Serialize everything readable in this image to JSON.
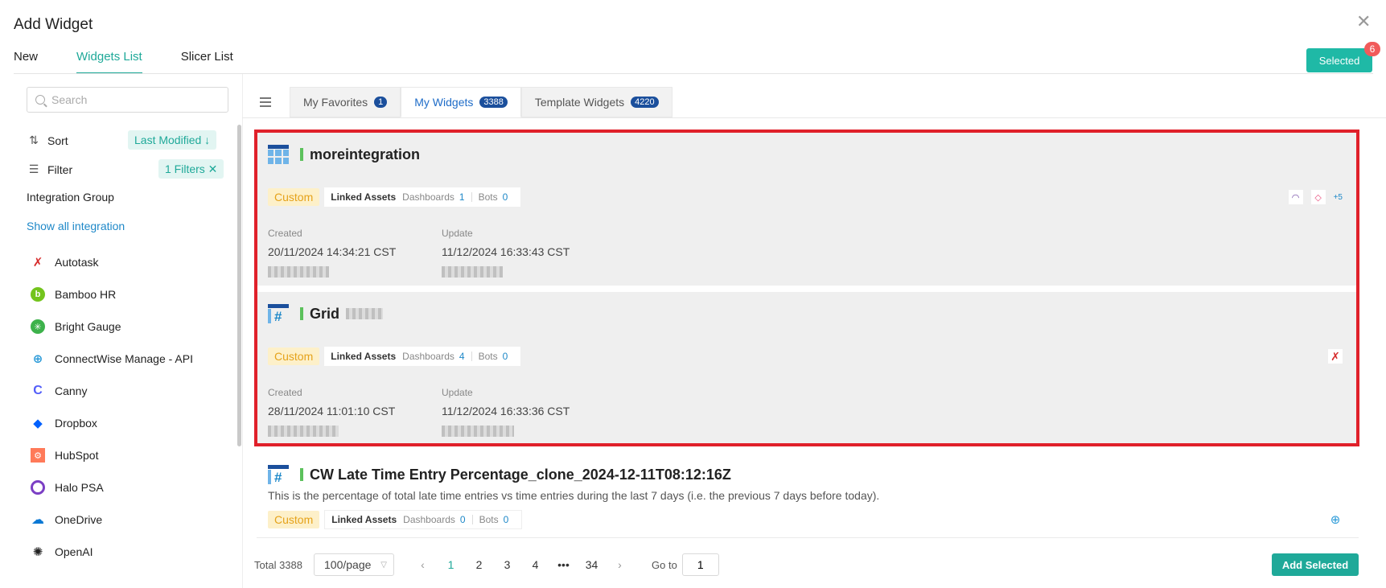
{
  "dialog": {
    "title": "Add Widget",
    "close": "✕"
  },
  "main_tabs": [
    {
      "label": "New"
    },
    {
      "label": "Widgets List"
    },
    {
      "label": "Slicer List"
    }
  ],
  "selected": {
    "label": "Selected",
    "count": "6"
  },
  "sidebar": {
    "search_placeholder": "Search",
    "sort_label": "Sort",
    "sort_value": "Last Modified ↓",
    "filter_label": "Filter",
    "filter_value": "1 Filters ✕",
    "integration_group": "Integration Group",
    "show_all": "Show all integration",
    "integrations": [
      {
        "name": "Autotask",
        "color": "#d62b2b"
      },
      {
        "name": "Bamboo HR",
        "color": "#73c41d"
      },
      {
        "name": "Bright Gauge",
        "color": "#3db24b"
      },
      {
        "name": "ConnectWise Manage - API",
        "color": "#2a9ad8"
      },
      {
        "name": "Canny",
        "color": "#525df9"
      },
      {
        "name": "Dropbox",
        "color": "#0061fe"
      },
      {
        "name": "HubSpot",
        "color": "#ff7a59"
      },
      {
        "name": "Halo PSA",
        "color": "#7b3fc4"
      },
      {
        "name": "OneDrive",
        "color": "#0a78d4"
      },
      {
        "name": "OpenAI",
        "color": "#222222"
      }
    ]
  },
  "sub_tabs": [
    {
      "label": "My Favorites",
      "count": "1"
    },
    {
      "label": "My Widgets",
      "count": "3388"
    },
    {
      "label": "Template Widgets",
      "count": "4220"
    }
  ],
  "widgets": [
    {
      "title": "moreintegration",
      "tag": "Custom",
      "linked_label": "Linked Assets",
      "dashboards_label": "Dashboards",
      "dashboards": "1",
      "bots_label": "Bots",
      "bots": "0",
      "created_label": "Created",
      "created": "20/11/2024 14:34:21 CST",
      "update_label": "Update",
      "update": "11/12/2024 16:33:43 CST",
      "more": "+5"
    },
    {
      "title": "Grid",
      "tag": "Custom",
      "linked_label": "Linked Assets",
      "dashboards_label": "Dashboards",
      "dashboards": "4",
      "bots_label": "Bots",
      "bots": "0",
      "created_label": "Created",
      "created": "28/11/2024 11:01:10 CST",
      "update_label": "Update",
      "update": "11/12/2024 16:33:36 CST"
    },
    {
      "title": "CW Late Time Entry Percentage_clone_2024-12-11T08:12:16Z",
      "description": "This is the percentage of total late time entries vs time entries during the last 7 days (i.e. the previous 7 days before today).",
      "tag": "Custom",
      "linked_label": "Linked Assets",
      "dashboards_label": "Dashboards",
      "dashboards": "0",
      "bots_label": "Bots",
      "bots": "0"
    }
  ],
  "pagination": {
    "total": "Total 3388",
    "page_size": "100/page",
    "pages": [
      "1",
      "2",
      "3",
      "4",
      "•••",
      "34"
    ],
    "goto_label": "Go to",
    "goto_value": "1"
  },
  "add_selected": "Add Selected",
  "colors": {
    "accent": "#1fa999",
    "badge": "#1b4f9c",
    "highlight_frame": "#e0202a"
  }
}
